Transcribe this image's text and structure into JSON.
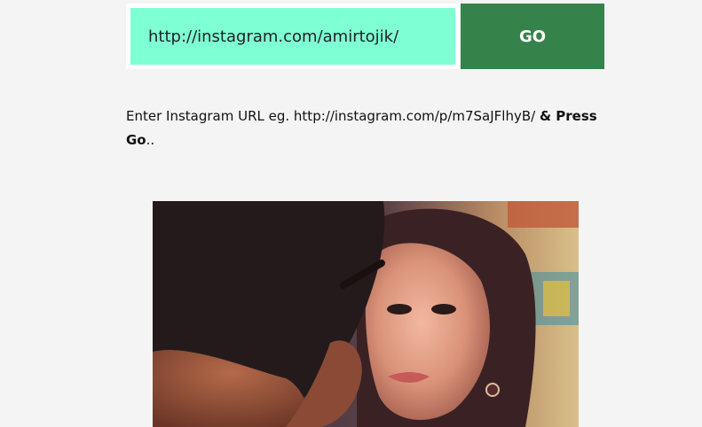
{
  "search": {
    "url_value": "http://instagram.com/amirtojik/",
    "go_label": "GO"
  },
  "instructions": {
    "prefix": "Enter Instagram URL eg. http://instagram.com/p/m7SaJFlhyB/ ",
    "bold_part1": "& Press Go",
    "suffix": ".."
  },
  "colors": {
    "input_bg": "#7fffd4",
    "button_bg": "#35824a",
    "page_bg": "#f4f4f4"
  },
  "media": {
    "image_alt": "instagram-photo"
  }
}
